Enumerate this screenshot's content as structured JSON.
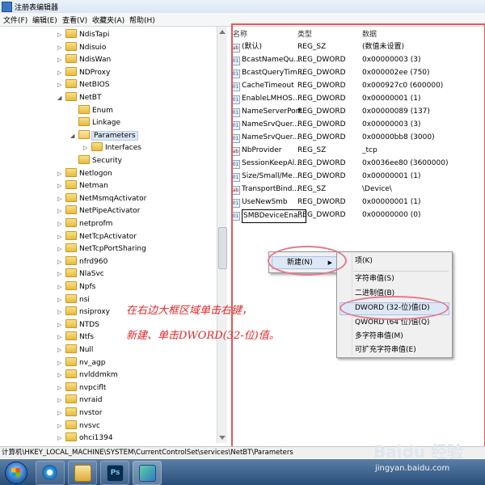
{
  "window": {
    "title": "注册表编辑器"
  },
  "menu": [
    "文件(F)",
    "编辑(E)",
    "查看(V)",
    "收藏夹(A)",
    "帮助(H)"
  ],
  "tree": [
    {
      "label": "NdisTapi",
      "depth": 0,
      "expand": "▷"
    },
    {
      "label": "Ndisuio",
      "depth": 0,
      "expand": "▷"
    },
    {
      "label": "NdisWan",
      "depth": 0,
      "expand": "▷"
    },
    {
      "label": "NDProxy",
      "depth": 0,
      "expand": "▷"
    },
    {
      "label": "NetBIOS",
      "depth": 0,
      "expand": "▷"
    },
    {
      "label": "NetBT",
      "depth": 0,
      "expand": "◢"
    },
    {
      "label": "Enum",
      "depth": 1,
      "expand": ""
    },
    {
      "label": "Linkage",
      "depth": 1,
      "expand": ""
    },
    {
      "label": "Parameters",
      "depth": 1,
      "expand": "◢",
      "selected": true
    },
    {
      "label": "Interfaces",
      "depth": 2,
      "expand": "▷"
    },
    {
      "label": "Security",
      "depth": 1,
      "expand": ""
    },
    {
      "label": "Netlogon",
      "depth": 0,
      "expand": "▷"
    },
    {
      "label": "Netman",
      "depth": 0,
      "expand": "▷"
    },
    {
      "label": "NetMsmqActivator",
      "depth": 0,
      "expand": "▷"
    },
    {
      "label": "NetPipeActivator",
      "depth": 0,
      "expand": "▷"
    },
    {
      "label": "netprofm",
      "depth": 0,
      "expand": "▷"
    },
    {
      "label": "NetTcpActivator",
      "depth": 0,
      "expand": "▷"
    },
    {
      "label": "NetTcpPortSharing",
      "depth": 0,
      "expand": "▷"
    },
    {
      "label": "nfrd960",
      "depth": 0,
      "expand": "▷"
    },
    {
      "label": "NlaSvc",
      "depth": 0,
      "expand": "▷"
    },
    {
      "label": "Npfs",
      "depth": 0,
      "expand": "▷"
    },
    {
      "label": "nsi",
      "depth": 0,
      "expand": "▷"
    },
    {
      "label": "nsiproxy",
      "depth": 0,
      "expand": "▷"
    },
    {
      "label": "NTDS",
      "depth": 0,
      "expand": "▷"
    },
    {
      "label": "Ntfs",
      "depth": 0,
      "expand": "▷"
    },
    {
      "label": "Null",
      "depth": 0,
      "expand": "▷"
    },
    {
      "label": "nv_agp",
      "depth": 0,
      "expand": "▷"
    },
    {
      "label": "nvlddmkm",
      "depth": 0,
      "expand": "▷"
    },
    {
      "label": "nvpciflt",
      "depth": 0,
      "expand": "▷"
    },
    {
      "label": "nvraid",
      "depth": 0,
      "expand": "▷"
    },
    {
      "label": "nvstor",
      "depth": 0,
      "expand": "▷"
    },
    {
      "label": "nvsvc",
      "depth": 0,
      "expand": "▷"
    },
    {
      "label": "ohci1394",
      "depth": 0,
      "expand": "▷"
    }
  ],
  "columns": {
    "name": "名称",
    "type": "类型",
    "data": "数据"
  },
  "values": [
    {
      "name": "(默认)",
      "type": "REG_SZ",
      "data": "(数值未设置)",
      "icon": "ab"
    },
    {
      "name": "BcastNameQu...",
      "type": "REG_DWORD",
      "data": "0x00000003 (3)",
      "icon": "01"
    },
    {
      "name": "BcastQueryTim...",
      "type": "REG_DWORD",
      "data": "0x000002ee (750)",
      "icon": "01"
    },
    {
      "name": "CacheTimeout",
      "type": "REG_DWORD",
      "data": "0x000927c0 (600000)",
      "icon": "01"
    },
    {
      "name": "EnableLMHOS...",
      "type": "REG_DWORD",
      "data": "0x00000001 (1)",
      "icon": "01"
    },
    {
      "name": "NameServerPort",
      "type": "REG_DWORD",
      "data": "0x00000089 (137)",
      "icon": "01"
    },
    {
      "name": "NameSrvQuer...",
      "type": "REG_DWORD",
      "data": "0x00000003 (3)",
      "icon": "01"
    },
    {
      "name": "NameSrvQuer...",
      "type": "REG_DWORD",
      "data": "0x00000bb8 (3000)",
      "icon": "01"
    },
    {
      "name": "NbProvider",
      "type": "REG_SZ",
      "data": "_tcp",
      "icon": "ab"
    },
    {
      "name": "SessionKeepAl...",
      "type": "REG_DWORD",
      "data": "0x0036ee80 (3600000)",
      "icon": "01"
    },
    {
      "name": "Size/Small/Me...",
      "type": "REG_DWORD",
      "data": "0x00000001 (1)",
      "icon": "01"
    },
    {
      "name": "TransportBind...",
      "type": "REG_SZ",
      "data": "\\Device\\",
      "icon": "ab"
    },
    {
      "name": "UseNewSmb",
      "type": "REG_DWORD",
      "data": "0x00000001 (1)",
      "icon": "01"
    },
    {
      "name": "SMBDeviceEna...",
      "type": "REG_DWORD",
      "data": "0x00000000 (0)",
      "icon": "01",
      "editing": true
    }
  ],
  "context_menu": {
    "new_label": "新建(N)",
    "arrow": "▶"
  },
  "submenu": [
    "项(K)",
    "字符串值(S)",
    "二进制值(B)",
    "DWORD (32-位)值(D)",
    "QWORD (64 位)值(Q)",
    "多字符串值(M)",
    "可扩充字符串值(E)"
  ],
  "annotation": {
    "line1": "在右边大框区域单击右键，",
    "line2": "新建、单击DWORD(32-位)值。"
  },
  "status": "计算机\\HKEY_LOCAL_MACHINE\\SYSTEM\\CurrentControlSet\\services\\NetBT\\Parameters",
  "taskbar": {
    "ps_label": "Ps"
  },
  "watermark": {
    "brand": "Baidu 经验",
    "url": "jingyan.baidu.com"
  }
}
